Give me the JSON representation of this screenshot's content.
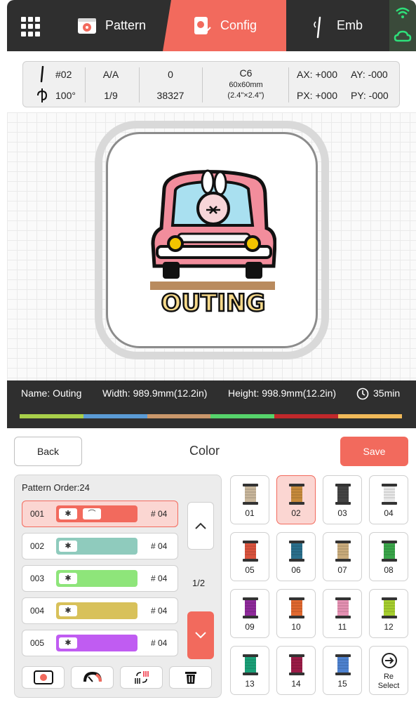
{
  "header": {
    "tabs": [
      {
        "label": "Pattern",
        "icon": "pattern-icon"
      },
      {
        "label": "Config",
        "icon": "config-icon",
        "active": true
      },
      {
        "label": "Emb",
        "icon": "needle-icon"
      }
    ],
    "accent": "#f26a5d"
  },
  "info": {
    "needle": "#02",
    "angle": "100°",
    "aa": "A/A",
    "frac": "1/9",
    "zero": "0",
    "stitches": "38327",
    "hoop": "C6",
    "hoop_mm": "60x60mm",
    "hoop_in": "(2.4\"×2.4\")",
    "ax": "AX: +000",
    "ay": "AY: -000",
    "px": "PX: +000",
    "py": "PY: -000"
  },
  "design": {
    "text": "OUTING"
  },
  "stats": {
    "name": "Name: Outing",
    "width": "Width: 989.9mm(12.2in)",
    "height": "Height: 998.9mm(12.2in)",
    "time": "35min",
    "colors": [
      "#a8cf4a",
      "#5b9bd5",
      "#c9976b",
      "#56d36b",
      "#c0282b",
      "#f0b959"
    ]
  },
  "bottom": {
    "back": "Back",
    "title": "Color",
    "save": "Save",
    "order_title": "Pattern Order:24",
    "page": "1/2",
    "rows": [
      {
        "num": "001",
        "code": "# 04",
        "color": "#f26a5d"
      },
      {
        "num": "002",
        "code": "# 04",
        "color": "#8fcbbd"
      },
      {
        "num": "003",
        "code": "# 04",
        "color": "#8ee57a"
      },
      {
        "num": "004",
        "code": "# 04",
        "color": "#d8c15a"
      },
      {
        "num": "005",
        "code": "# 04",
        "color": "#c05cf2"
      }
    ],
    "threads": [
      {
        "label": "01",
        "color": "#c9b79c"
      },
      {
        "label": "02",
        "color": "#c68a3c"
      },
      {
        "label": "03",
        "color": "#444444"
      },
      {
        "label": "04",
        "color": "#e8e8e8"
      },
      {
        "label": "05",
        "color": "#d9533d"
      },
      {
        "label": "06",
        "color": "#2a6f8c"
      },
      {
        "label": "07",
        "color": "#c9ab7c"
      },
      {
        "label": "08",
        "color": "#3aa64a"
      },
      {
        "label": "09",
        "color": "#8f2a9b"
      },
      {
        "label": "10",
        "color": "#e0682f"
      },
      {
        "label": "11",
        "color": "#e591b3"
      },
      {
        "label": "12",
        "color": "#a6cf2e"
      },
      {
        "label": "13",
        "color": "#1aa078"
      },
      {
        "label": "14",
        "color": "#9b1c47"
      },
      {
        "label": "15",
        "color": "#4e82d0"
      }
    ],
    "reselect": [
      "Re",
      "Select"
    ]
  }
}
